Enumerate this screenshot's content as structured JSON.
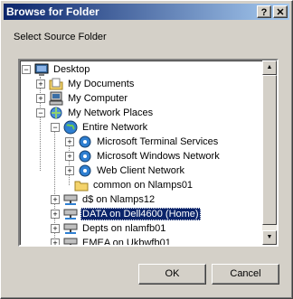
{
  "window": {
    "title": "Browse for Folder",
    "help_label": "?",
    "close_label": "✕"
  },
  "prompt": "Select Source Folder",
  "tree": {
    "items": [
      {
        "label": "Desktop",
        "icon": "desktop-icon"
      },
      {
        "label": "My Documents",
        "icon": "folder-documents-icon"
      },
      {
        "label": "My Computer",
        "icon": "computer-icon"
      },
      {
        "label": "My Network Places",
        "icon": "network-places-icon"
      },
      {
        "label": "Entire Network",
        "icon": "globe-icon"
      },
      {
        "label": "Microsoft Terminal Services",
        "icon": "network-icon"
      },
      {
        "label": "Microsoft Windows Network",
        "icon": "network-icon"
      },
      {
        "label": "Web Client Network",
        "icon": "network-icon"
      },
      {
        "label": "common on Nlamps01",
        "icon": "folder-icon"
      },
      {
        "label": "d$ on Nlamps12",
        "icon": "network-drive-icon"
      },
      {
        "label": "DATA on Dell4600 (Home)",
        "icon": "network-drive-icon",
        "selected": true
      },
      {
        "label": "Depts on nlamfb01",
        "icon": "network-drive-icon"
      },
      {
        "label": "EMEA on Ukbwfb01",
        "icon": "network-drive-icon"
      }
    ],
    "scroll_up": "▲",
    "scroll_down": "▼"
  },
  "buttons": {
    "ok": "OK",
    "cancel": "Cancel"
  },
  "colors": {
    "title_bar": "#0a246a",
    "selection": "#0a246a",
    "face": "#d4d0c8"
  }
}
